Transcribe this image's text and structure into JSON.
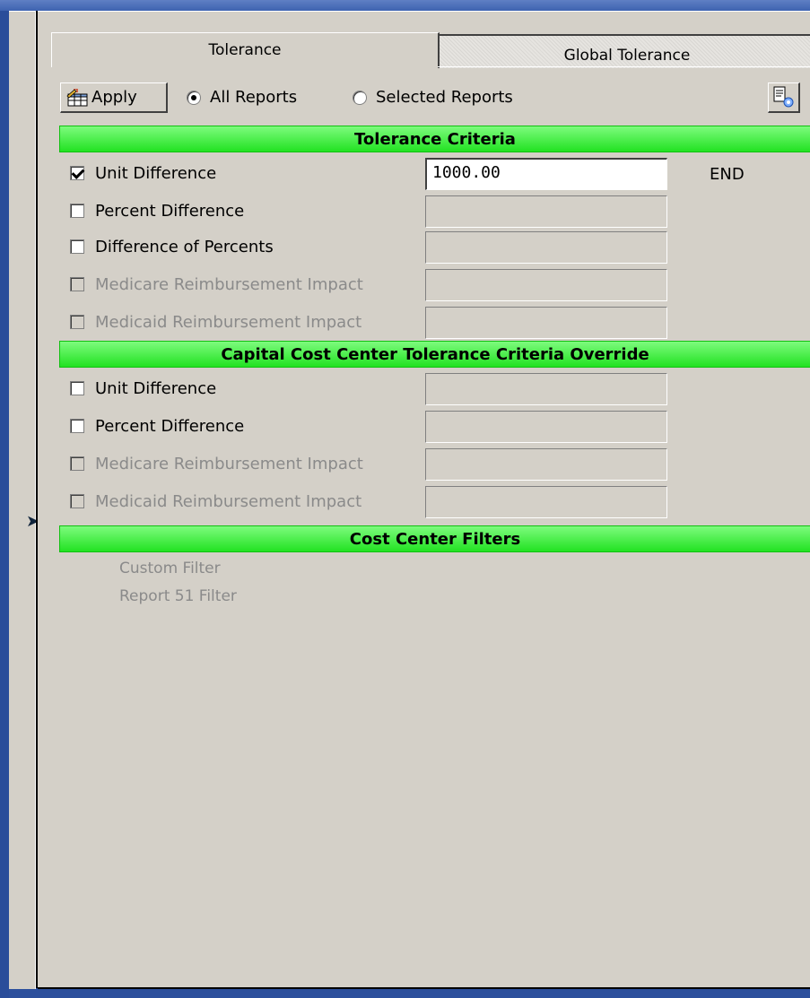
{
  "tabs": {
    "tolerance": "Tolerance",
    "global_tolerance": "Global Tolerance"
  },
  "toolbar": {
    "apply_label": "Apply",
    "all_reports_label": "All Reports",
    "selected_reports_label": "Selected Reports"
  },
  "sections": {
    "tolerance_criteria": "Tolerance Criteria",
    "capital_override": "Capital Cost Center Tolerance Criteria Override",
    "filters": "Cost Center Filters"
  },
  "tolerance_rows": [
    {
      "label": "Unit Difference",
      "value": "1000.00"
    },
    {
      "label": "Percent Difference",
      "value": ""
    },
    {
      "label": "Difference of Percents",
      "value": ""
    },
    {
      "label": "Medicare Reimbursement Impact",
      "value": ""
    },
    {
      "label": "Medicaid Reimbursement Impact",
      "value": ""
    }
  ],
  "end_label": "END",
  "capital_rows": [
    {
      "label": "Unit Difference",
      "value": ""
    },
    {
      "label": "Percent Difference",
      "value": ""
    },
    {
      "label": "Medicare Reimbursement Impact",
      "value": ""
    },
    {
      "label": "Medicaid Reimbursement Impact",
      "value": ""
    }
  ],
  "filters": [
    "Custom Filter",
    "Report 51 Filter"
  ]
}
